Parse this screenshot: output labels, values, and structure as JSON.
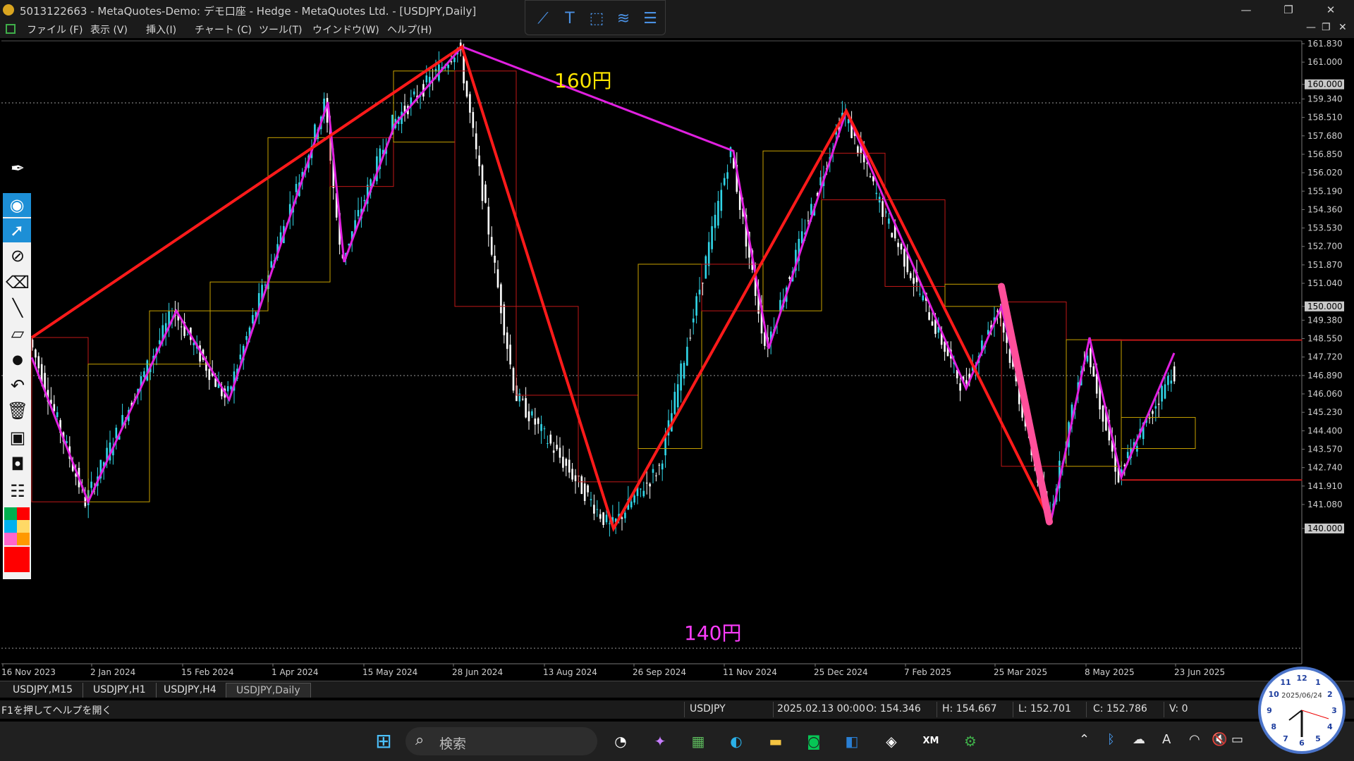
{
  "titlebar": {
    "title": "5013122663 - MetaQuotes-Demo: デモ口座 - Hedge - MetaQuotes Ltd. - [USDJPY,Daily]",
    "minimize": "—",
    "restore": "❐",
    "close": "✕"
  },
  "quick_tools": [
    "line-tool",
    "text-tool",
    "rect-tool",
    "fibo-tool",
    "channel-tool"
  ],
  "menu": {
    "items": [
      "ファイル (F)",
      "表示 (V)",
      "挿入(I)",
      "チャート (C)",
      "ツール(T)",
      "ウインドウ(W)",
      "ヘルプ(H)"
    ],
    "mdi": [
      "—",
      "❐",
      "✕"
    ]
  },
  "chart": {
    "symbol": "USDJPY",
    "timeframe": "Daily",
    "price_axis": [
      "161.830",
      "161.000",
      "160.000",
      "159.340",
      "158.510",
      "157.680",
      "156.850",
      "156.020",
      "155.190",
      "154.360",
      "153.530",
      "152.700",
      "151.870",
      "151.040",
      "150.000",
      "149.380",
      "148.550",
      "147.720",
      "146.890",
      "146.060",
      "145.230",
      "144.400",
      "143.570",
      "142.740",
      "141.910",
      "141.080",
      "140.000"
    ],
    "highlighted_levels": [
      "160.000",
      "150.000",
      "140.000"
    ],
    "date_axis": [
      "16 Nov 2023",
      "2 Jan 2024",
      "15 Feb 2024",
      "1 Apr 2024",
      "15 May 2024",
      "28 Jun 2024",
      "13 Aug 2024",
      "26 Sep 2024",
      "11 Nov 2024",
      "25 Dec 2024",
      "7 Feb 2025",
      "25 Mar 2025",
      "8 May 2025",
      "23 Jun 2025"
    ],
    "annotations": {
      "label_160": "160円",
      "label_140": "140円"
    },
    "colors": {
      "bull_candle": "#31d6e8",
      "bear_candle": "#ffffff",
      "zigzag_major": "#ff1a1a",
      "zigzag_minor": "#e020e0",
      "highlight_stroke": "#ff4f9a",
      "label_160": "#ffe600",
      "label_140": "#ff3cff",
      "box_yellow": "#c8a200",
      "box_red": "#c01818"
    }
  },
  "left_toolbar": [
    "pen-icon",
    "eye-icon",
    "cursor-icon",
    "crosshair-icon",
    "eraser-icon",
    "line-icon",
    "ruler-icon",
    "dot-icon",
    "undo-icon",
    "trash-icon",
    "screen-icon",
    "camera-icon",
    "clipboard-icon"
  ],
  "color_palette": [
    "#00b050",
    "#ff0000",
    "#00b0f0",
    "#ffd966",
    "#ff66cc",
    "#ff0000"
  ],
  "tabs": [
    "USDJPY,M15",
    "USDJPY,H1",
    "USDJPY,H4",
    "USDJPY,Daily"
  ],
  "status": {
    "help": "F1を押してヘルプを開く",
    "symbol": "USDJPY",
    "datetime": "2025.02.13 00:00",
    "open": "O: 154.346",
    "high": "H: 154.667",
    "low": "L: 152.701",
    "close": "C: 152.786",
    "volume": "V: 0"
  },
  "taskbar": {
    "search_label": "検索",
    "apps": [
      "windows-start-icon",
      "widgets-icon",
      "copilot-icon",
      "store-icon",
      "edge-icon",
      "explorer-icon",
      "line-app-icon",
      "outlook-icon",
      "vpn-icon",
      "xm-icon",
      "metatrader-icon"
    ],
    "tray": [
      "chevron-up-icon",
      "bluetooth-icon",
      "cloud-icon",
      "font-icon",
      "wifi-icon",
      "mute-icon",
      "battery-icon"
    ],
    "clock_date": "2025/06/24"
  }
}
